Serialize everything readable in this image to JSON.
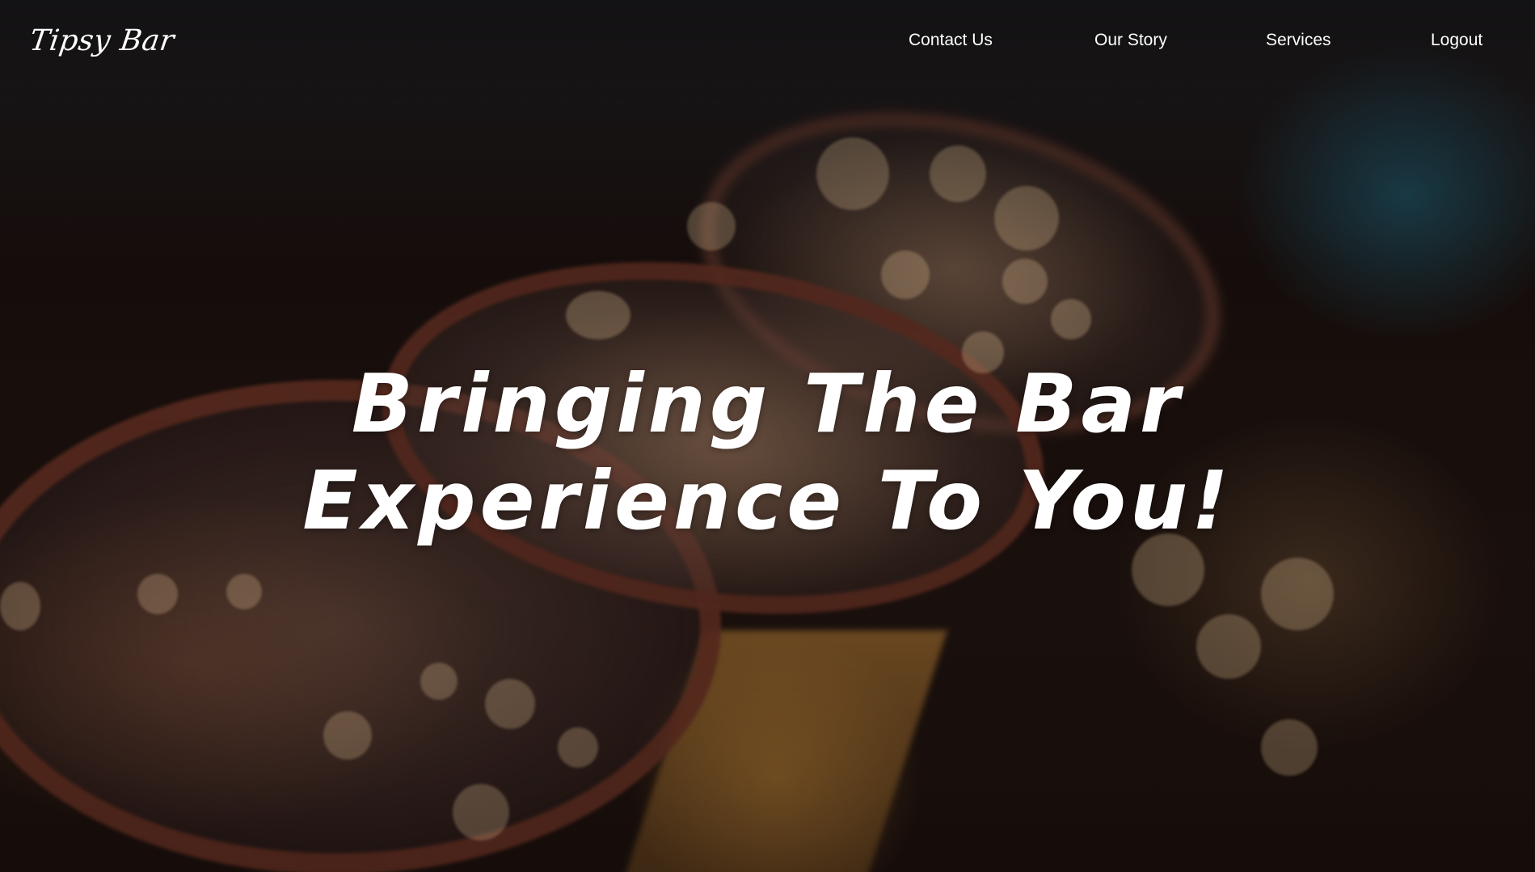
{
  "brand": {
    "logo_text": "Tipsy Bar"
  },
  "nav": {
    "items": [
      {
        "label": "Contact Us"
      },
      {
        "label": "Our Story"
      },
      {
        "label": "Services"
      },
      {
        "label": "Logout"
      }
    ]
  },
  "hero": {
    "line1": "Bringing The Bar",
    "line2": "Experience To You!"
  },
  "colors": {
    "text": "#ffffff",
    "background": "#140a08"
  }
}
